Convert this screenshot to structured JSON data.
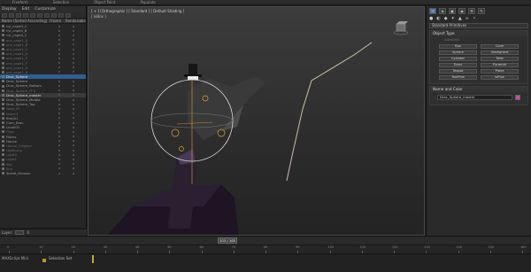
{
  "ribbon": {
    "tabs": [
      "Freeform",
      "Selection",
      "Object Paint",
      "Populate"
    ]
  },
  "explorer": {
    "menu": [
      "Display",
      "Edit",
      "Customize"
    ],
    "columns": {
      "name": "Name (Sorted Ascending)",
      "frozen": "Frozen",
      "renderable": "Renderable"
    },
    "rows": [
      {
        "name": "cyl_cape0_C",
        "style": ""
      },
      {
        "name": "cyl_cape0_B",
        "style": ""
      },
      {
        "name": "cyl_cape0_C",
        "style": ""
      },
      {
        "name": "pnt_cape1_A",
        "style": "dim"
      },
      {
        "name": "pnt_cape1_B",
        "style": "dim"
      },
      {
        "name": "pnt_cape1_C",
        "style": "dim"
      },
      {
        "name": "pnt_cape1_D",
        "style": "dim"
      },
      {
        "name": "pnt_cape1_E",
        "style": "dim"
      },
      {
        "name": "pnt_cape1_F",
        "style": "dim"
      },
      {
        "name": "pnt_cape1_G",
        "style": "dim"
      },
      {
        "name": "pnt_cape1_H",
        "style": "dim"
      },
      {
        "name": "Drac_Sphere",
        "style": "sel"
      },
      {
        "name": "Drac_Sphere",
        "style": ""
      },
      {
        "name": "Drac_Sphere_Bottom",
        "style": ""
      },
      {
        "name": "Drac_Sphere_FFD",
        "style": "dim"
      },
      {
        "name": "Drac_Sphere_master",
        "style": "hl"
      },
      {
        "name": "Drac_Sphere_Middle",
        "style": ""
      },
      {
        "name": "Drac_Sphere_Top",
        "style": ""
      },
      {
        "name": "Fade_02",
        "style": "dim"
      },
      {
        "name": "fade01",
        "style": "dim"
      },
      {
        "name": "fire001",
        "style": ""
      },
      {
        "name": "Cam_Drac",
        "style": ""
      },
      {
        "name": "Line001",
        "style": ""
      },
      {
        "name": "Flaw",
        "style": "dim"
      },
      {
        "name": "Filters",
        "style": ""
      },
      {
        "name": "House",
        "style": ""
      },
      {
        "name": "House_Original",
        "style": "dim"
      },
      {
        "name": "Lightning",
        "style": "dim"
      },
      {
        "name": "Light0",
        "style": "dim"
      },
      {
        "name": "Light1",
        "style": "dim"
      },
      {
        "name": "Sky",
        "style": "dim"
      },
      {
        "name": "Env",
        "style": "dim"
      },
      {
        "name": "Street_Houses",
        "style": ""
      }
    ]
  },
  "layers": {
    "label": "Layer:",
    "value": "0"
  },
  "viewport": {
    "label": "[ + ] [Orthographic ] [ Standard ] [ Default Shading ]",
    "sub": "[ loBox ]"
  },
  "command_panel": {
    "tabs": [
      "+",
      "◈",
      "▣",
      "◉",
      "⚙",
      "✎"
    ],
    "category_icons": [
      "●",
      "◐",
      "◆",
      "✦",
      "▲",
      "≈",
      "⚬"
    ],
    "dropdown": "Standard Primitives",
    "object_type": {
      "title": "Object Type",
      "autogrid": "AutoGrid",
      "buttons": [
        "Box",
        "Cone",
        "Sphere",
        "GeoSphere",
        "Cylinder",
        "Tube",
        "Torus",
        "Pyramid",
        "Teapot",
        "Plane",
        "TextPlus",
        "loPlus"
      ]
    },
    "name_color": {
      "title": "Name and Color",
      "name": "Drac_Sphere_master",
      "color": "#c24fa3"
    }
  },
  "timeline": {
    "frame": "103 / 165",
    "ticks": [
      "0",
      "10",
      "20",
      "30",
      "40",
      "50",
      "60",
      "70",
      "80",
      "90",
      "100",
      "110",
      "120",
      "130",
      "140",
      "150",
      "160"
    ]
  },
  "status": {
    "left": "MAXScript Mini",
    "selection": "Selection Set"
  }
}
